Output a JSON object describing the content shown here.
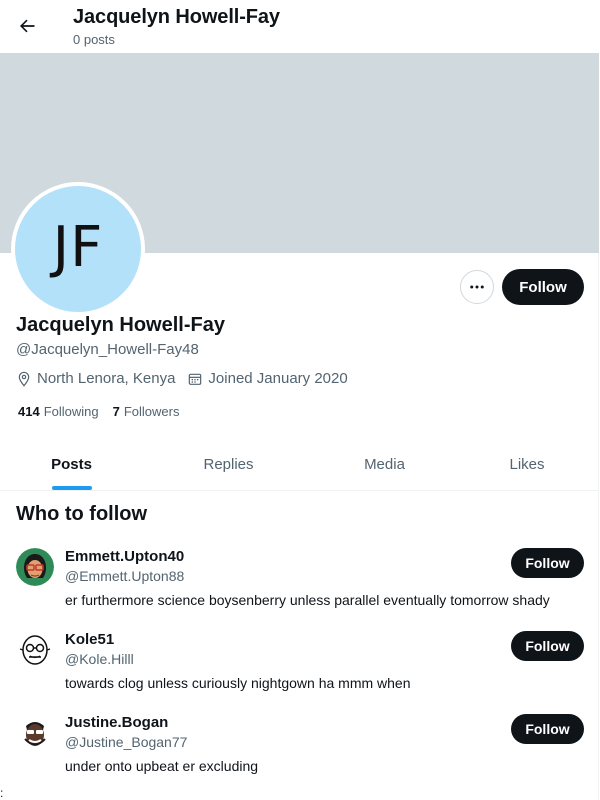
{
  "header": {
    "title": "Jacquelyn Howell-Fay",
    "post_count": "0 posts",
    "back_icon": "arrow-left-icon"
  },
  "profile": {
    "avatar_initials": "JF",
    "avatar_color": "#b4e1fa",
    "banner_color": "#cfd9de",
    "display_name": "Jacquelyn Howell-Fay",
    "handle": "@Jacquelyn_Howell-Fay48",
    "location": "North Lenora, Kenya",
    "joined": "Joined January 2020",
    "following_count": "414",
    "following_label": "Following",
    "followers_count": "7",
    "followers_label": "Followers",
    "follow_label": "Follow"
  },
  "tabs": [
    {
      "label": "Posts",
      "active": true
    },
    {
      "label": "Replies",
      "active": false
    },
    {
      "label": "Media",
      "active": false
    },
    {
      "label": "Likes",
      "active": false
    }
  ],
  "who_to_follow": {
    "title": "Who to follow",
    "items": [
      {
        "name": "Emmett.Upton40",
        "handle": "@Emmett.Upton88",
        "bio": "er furthermore science boysenberry unless parallel eventually tomorrow shady",
        "follow_label": "Follow"
      },
      {
        "name": "Kole51",
        "handle": "@Kole.Hilll",
        "bio": "towards clog unless curiously nightgown ha mmm when",
        "follow_label": "Follow"
      },
      {
        "name": "Justine.Bogan",
        "handle": "@Justine_Bogan77",
        "bio": "under onto upbeat er excluding",
        "follow_label": "Follow"
      }
    ]
  },
  "colors": {
    "accent": "#1d9bf0",
    "button_dark": "#0f1419",
    "secondary_text": "#536471"
  },
  "footer_mark": ":"
}
